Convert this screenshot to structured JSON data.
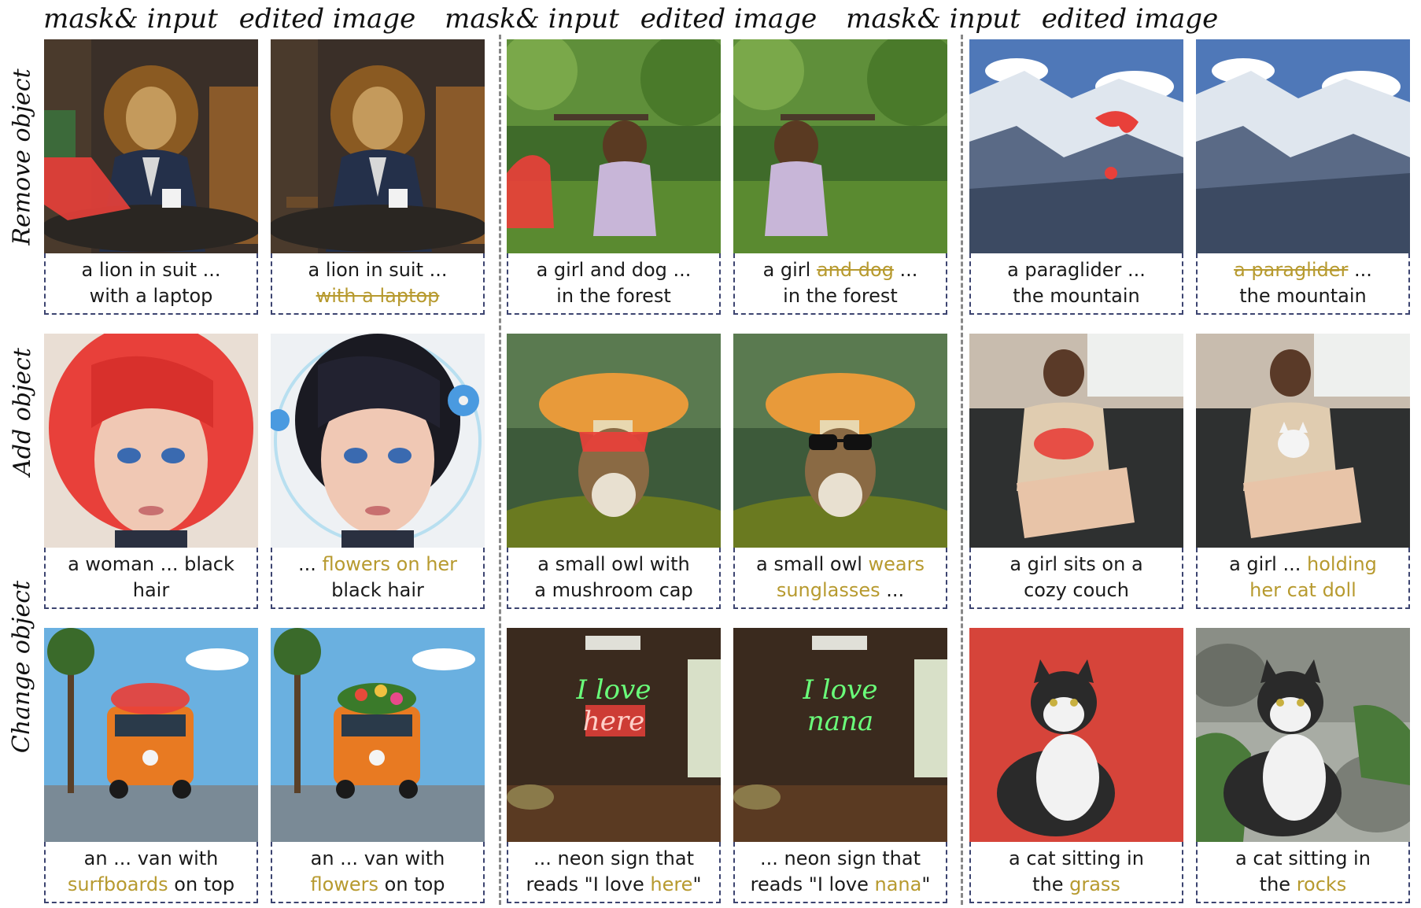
{
  "headers": [
    "mask& input",
    "edited image",
    "mask& input",
    "edited image",
    "mask& input",
    "edited image"
  ],
  "row_labels": [
    "Remove object",
    "Add object",
    "Change object"
  ],
  "captions": [
    [
      {
        "line1": [
          "a lion in suit ..."
        ],
        "line2": [
          "with a laptop"
        ]
      },
      {
        "line1": [
          "a lion in suit ..."
        ],
        "line2_struck": "with a laptop"
      },
      {
        "line1": [
          "a girl and dog ..."
        ],
        "line2": [
          "in the forest"
        ]
      },
      {
        "line1_a": "a girl ",
        "line1_struck": "and dog",
        "line1_b": " ...",
        "line2": [
          "in the forest"
        ]
      },
      {
        "line1": [
          "a paraglider ..."
        ],
        "line2": [
          "the mountain"
        ]
      },
      {
        "line1_struck": "a paraglider",
        "line1_b": " ...",
        "line2": [
          "the mountain"
        ]
      }
    ],
    [
      {
        "line1": [
          "a woman ... black"
        ],
        "line2": [
          "hair"
        ]
      },
      {
        "line1_a": "... ",
        "line1_hl": "flowers on her",
        "line2": [
          "black hair"
        ]
      },
      {
        "line1": [
          "a small owl with"
        ],
        "line2": [
          "a mushroom cap"
        ]
      },
      {
        "line1_a": "a small owl ",
        "line1_hl": "wears",
        "line2_hl": "sunglasses",
        "line2_b": " ..."
      },
      {
        "line1": [
          "a girl sits on a"
        ],
        "line2": [
          "cozy couch"
        ]
      },
      {
        "line1_a": "a girl ... ",
        "line1_hl": "holding",
        "line2_hl": "her cat doll"
      }
    ],
    [
      {
        "line1": [
          "an ... van with"
        ],
        "line2_hl": "surfboards",
        "line2_b": " on top"
      },
      {
        "line1": [
          "an ... van with"
        ],
        "line2_hl": "flowers",
        "line2_b": " on top"
      },
      {
        "line1": [
          "... neon sign that"
        ],
        "line2_a": "reads \"I love ",
        "line2_hl": "here",
        "line2_b": "\""
      },
      {
        "line1": [
          "... neon sign that"
        ],
        "line2_a": "reads \"I love ",
        "line2_hl": "nana",
        "line2_b": "\""
      },
      {
        "line1": [
          "a cat sitting in"
        ],
        "line2_a": "the ",
        "line2_hl": "grass"
      },
      {
        "line1": [
          "a cat sitting in"
        ],
        "line2_a": "the ",
        "line2_hl": "rocks"
      }
    ]
  ],
  "neon_text": {
    "input": [
      "I love",
      "here"
    ],
    "edited": [
      "I love",
      "nana"
    ]
  },
  "colors": {
    "highlight": "#b79a2f",
    "mask": "#e8403a",
    "border": "#3c4470"
  }
}
